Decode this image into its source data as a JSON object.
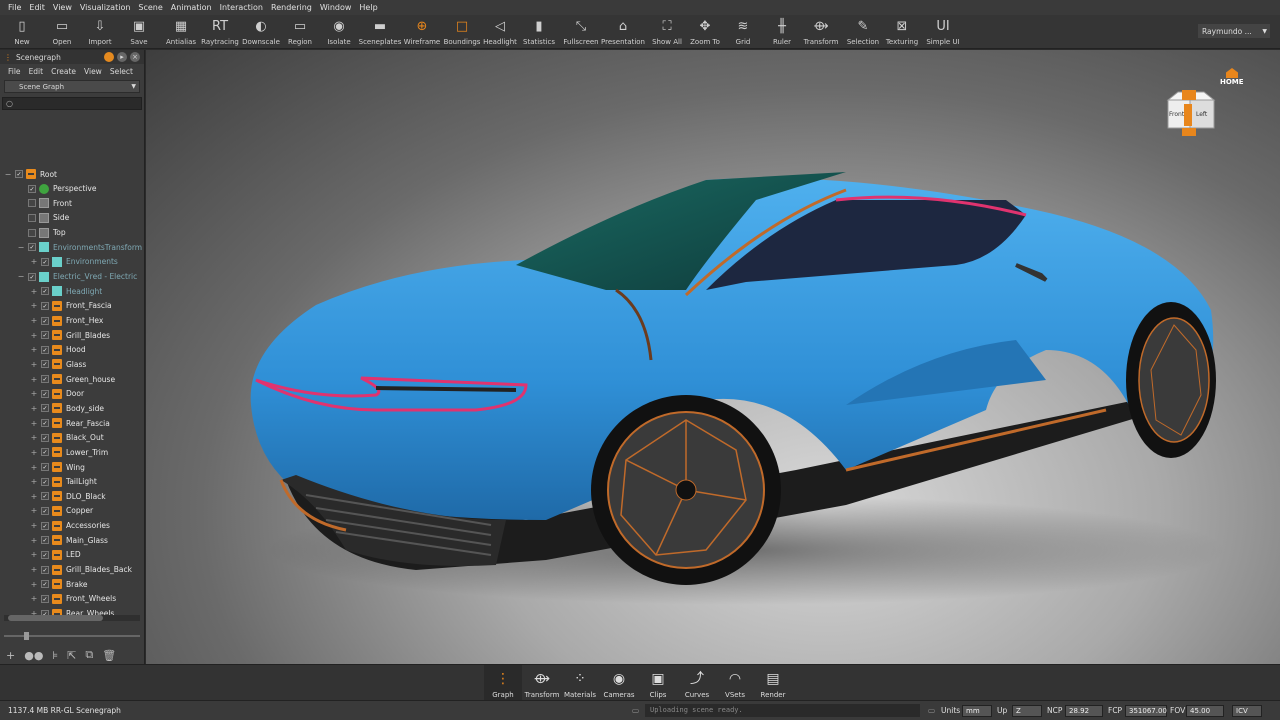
{
  "menubar": [
    "File",
    "Edit",
    "View",
    "Visualization",
    "Scene",
    "Animation",
    "Interaction",
    "Rendering",
    "Window",
    "Help"
  ],
  "toolbar": [
    {
      "label": "New",
      "icon": "new-file-icon",
      "glyph": "▯"
    },
    {
      "label": "Open",
      "icon": "open-folder-icon",
      "glyph": "▭"
    },
    {
      "label": "Import",
      "icon": "import-icon",
      "glyph": "⇩"
    },
    {
      "label": "Save",
      "icon": "save-icon",
      "glyph": "▣"
    },
    {
      "label": "Antialias",
      "icon": "antialias-icon",
      "glyph": "▦"
    },
    {
      "label": "Raytracing",
      "icon": "raytracing-icon",
      "glyph": "RT"
    },
    {
      "label": "Downscale",
      "icon": "downscale-icon",
      "glyph": "◐"
    },
    {
      "label": "Region",
      "icon": "region-icon",
      "glyph": "▭"
    },
    {
      "label": "Isolate",
      "icon": "isolate-icon",
      "glyph": "◉"
    },
    {
      "label": "Sceneplates",
      "icon": "sceneplates-icon",
      "glyph": "▬"
    },
    {
      "label": "Wireframe",
      "icon": "wireframe-icon",
      "glyph": "⊕"
    },
    {
      "label": "Boundings",
      "icon": "boundings-icon",
      "glyph": "□"
    },
    {
      "label": "Headlight",
      "icon": "headlight-icon",
      "glyph": "◁"
    },
    {
      "label": "Statistics",
      "icon": "statistics-icon",
      "glyph": "▮"
    },
    {
      "label": "Fullscreen",
      "icon": "fullscreen-icon",
      "glyph": "⤡"
    },
    {
      "label": "Presentation",
      "icon": "presentation-icon",
      "glyph": "⌂"
    },
    {
      "label": "Show All",
      "icon": "show-all-icon",
      "glyph": "⛶"
    },
    {
      "label": "Zoom To",
      "icon": "zoom-to-icon",
      "glyph": "✥"
    },
    {
      "label": "Grid",
      "icon": "grid-icon",
      "glyph": "≋"
    },
    {
      "label": "Ruler",
      "icon": "ruler-icon",
      "glyph": "╫"
    },
    {
      "label": "Transform",
      "icon": "transform-icon",
      "glyph": "⟴"
    },
    {
      "label": "Selection",
      "icon": "selection-icon",
      "glyph": "✎"
    },
    {
      "label": "Texturing",
      "icon": "texturing-icon",
      "glyph": "⊠"
    },
    {
      "label": "Simple UI",
      "icon": "simple-ui-icon",
      "glyph": "UI"
    }
  ],
  "user": {
    "name": "Raymundo ..."
  },
  "panel": {
    "title": "Scenegraph",
    "menu": [
      "File",
      "Edit",
      "Create",
      "View",
      "Select"
    ],
    "view_select": "Scene Graph",
    "search_placeholder": ""
  },
  "tree": [
    {
      "label": "Root",
      "icon": "org",
      "indent": 0,
      "exp": "−",
      "cb": "✓"
    },
    {
      "label": "Perspective",
      "icon": "grn",
      "indent": 1,
      "exp": "",
      "cb": "✓"
    },
    {
      "label": "Front",
      "icon": "cam",
      "indent": 1,
      "exp": "",
      "cb": ""
    },
    {
      "label": "Side",
      "icon": "cam",
      "indent": 1,
      "exp": "",
      "cb": ""
    },
    {
      "label": "Top",
      "icon": "cam",
      "indent": 1,
      "exp": "",
      "cb": ""
    },
    {
      "label": "EnvironmentsTransform",
      "icon": "env",
      "indent": 1,
      "exp": "−",
      "cb": "✓",
      "dim": true
    },
    {
      "label": "Environments",
      "icon": "env",
      "indent": 2,
      "exp": "+",
      "cb": "✓",
      "dim": true
    },
    {
      "label": "Electric_Vred - Electric",
      "icon": "env",
      "indent": 1,
      "exp": "−",
      "cb": "✓",
      "dim": true
    },
    {
      "label": "Headlight",
      "icon": "env",
      "indent": 2,
      "exp": "+",
      "cb": "✓",
      "dim": true
    },
    {
      "label": "Front_Fascia",
      "icon": "org",
      "indent": 2,
      "exp": "+",
      "cb": "✓"
    },
    {
      "label": "Front_Hex",
      "icon": "org",
      "indent": 2,
      "exp": "+",
      "cb": "✓"
    },
    {
      "label": "Grill_Blades",
      "icon": "org",
      "indent": 2,
      "exp": "+",
      "cb": "✓"
    },
    {
      "label": "Hood",
      "icon": "org",
      "indent": 2,
      "exp": "+",
      "cb": "✓"
    },
    {
      "label": "Glass",
      "icon": "org",
      "indent": 2,
      "exp": "+",
      "cb": "✓"
    },
    {
      "label": "Green_house",
      "icon": "org",
      "indent": 2,
      "exp": "+",
      "cb": "✓"
    },
    {
      "label": "Door",
      "icon": "org",
      "indent": 2,
      "exp": "+",
      "cb": "✓"
    },
    {
      "label": "Body_side",
      "icon": "org",
      "indent": 2,
      "exp": "+",
      "cb": "✓"
    },
    {
      "label": "Rear_Fascia",
      "icon": "org",
      "indent": 2,
      "exp": "+",
      "cb": "✓"
    },
    {
      "label": "Black_Out",
      "icon": "org",
      "indent": 2,
      "exp": "+",
      "cb": "✓"
    },
    {
      "label": "Lower_Trim",
      "icon": "org",
      "indent": 2,
      "exp": "+",
      "cb": "✓"
    },
    {
      "label": "Wing",
      "icon": "org",
      "indent": 2,
      "exp": "+",
      "cb": "✓"
    },
    {
      "label": "TailLight",
      "icon": "org",
      "indent": 2,
      "exp": "+",
      "cb": "✓"
    },
    {
      "label": "DLO_Black",
      "icon": "org",
      "indent": 2,
      "exp": "+",
      "cb": "✓"
    },
    {
      "label": "Copper",
      "icon": "org",
      "indent": 2,
      "exp": "+",
      "cb": "✓"
    },
    {
      "label": "Accessories",
      "icon": "org",
      "indent": 2,
      "exp": "+",
      "cb": "✓"
    },
    {
      "label": "Main_Glass",
      "icon": "org",
      "indent": 2,
      "exp": "+",
      "cb": "✓"
    },
    {
      "label": "LED",
      "icon": "org",
      "indent": 2,
      "exp": "+",
      "cb": "✓"
    },
    {
      "label": "Grill_Blades_Back",
      "icon": "org",
      "indent": 2,
      "exp": "+",
      "cb": "✓"
    },
    {
      "label": "Brake",
      "icon": "org",
      "indent": 2,
      "exp": "+",
      "cb": "✓"
    },
    {
      "label": "Front_Wheels",
      "icon": "org",
      "indent": 2,
      "exp": "+",
      "cb": "✓"
    },
    {
      "label": "Rear_Wheels",
      "icon": "org",
      "indent": 2,
      "exp": "+",
      "cb": "✓"
    }
  ],
  "viewport": {
    "home_label": "HOME",
    "navcube_front": "Front",
    "navcube_left": "Left",
    "car_color": "#2f8fd6"
  },
  "dock": [
    {
      "label": "Graph",
      "icon": "graph-icon",
      "glyph": "⋮",
      "active": true
    },
    {
      "label": "Transform",
      "icon": "transform-dock-icon",
      "glyph": "⟴"
    },
    {
      "label": "Materials",
      "icon": "materials-icon",
      "glyph": "⁘"
    },
    {
      "label": "Cameras",
      "icon": "cameras-icon",
      "glyph": "◉"
    },
    {
      "label": "Clips",
      "icon": "clips-icon",
      "glyph": "▣"
    },
    {
      "label": "Curves",
      "icon": "curves-icon",
      "glyph": "⤴"
    },
    {
      "label": "VSets",
      "icon": "vsets-icon",
      "glyph": "◠"
    },
    {
      "label": "Render",
      "icon": "render-icon",
      "glyph": "▤"
    }
  ],
  "status": {
    "memory": "1137.4 MB  RR-GL  Scenegraph",
    "message": "Uploading scene ready.",
    "units_label": "Units",
    "units_value": "mm",
    "up_label": "Up",
    "up_value": "Z",
    "ncp_label": "NCP",
    "ncp_value": "28.92",
    "fcp_label": "FCP",
    "fcp_value": "351067.00",
    "fov_label": "FOV",
    "fov_value": "45.00",
    "icv_value": "ICV"
  },
  "colors": {
    "accent": "#e8861c",
    "car_blue": "#2f8fd6",
    "copper": "#c06a2a",
    "led": "#e0336f"
  }
}
